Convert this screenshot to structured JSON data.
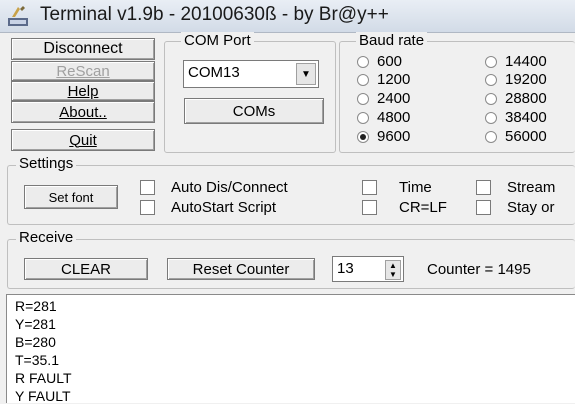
{
  "window": {
    "title": "Terminal v1.9b - 20100630ß - by Br@y++"
  },
  "left_buttons": {
    "disconnect": "Disconnect",
    "rescan": "ReScan",
    "help": "Help",
    "about": "About..",
    "quit": "Quit"
  },
  "com_port": {
    "group_label": "COM Port",
    "selected": "COM13",
    "coms_button": "COMs"
  },
  "baud": {
    "group_label": "Baud rate",
    "options": [
      "600",
      "1200",
      "2400",
      "4800",
      "9600",
      "14400",
      "19200",
      "28800",
      "38400",
      "56000"
    ],
    "selected": "9600"
  },
  "settings": {
    "group_label": "Settings",
    "set_font": "Set font",
    "auto_dis_connect": "Auto Dis/Connect",
    "autostart_script": "AutoStart Script",
    "time": "Time",
    "cr_lf": "CR=LF",
    "stream": "Stream",
    "stay_on": "Stay or"
  },
  "receive": {
    "group_label": "Receive",
    "clear": "CLEAR",
    "reset_counter": "Reset Counter",
    "spin_value": "13",
    "counter_label": "Counter = ",
    "counter_value": "1495"
  },
  "output": {
    "lines": [
      "R=281",
      "Y=281",
      "B=280",
      "T=35.1",
      "R FAULT",
      "Y FAULT"
    ]
  }
}
